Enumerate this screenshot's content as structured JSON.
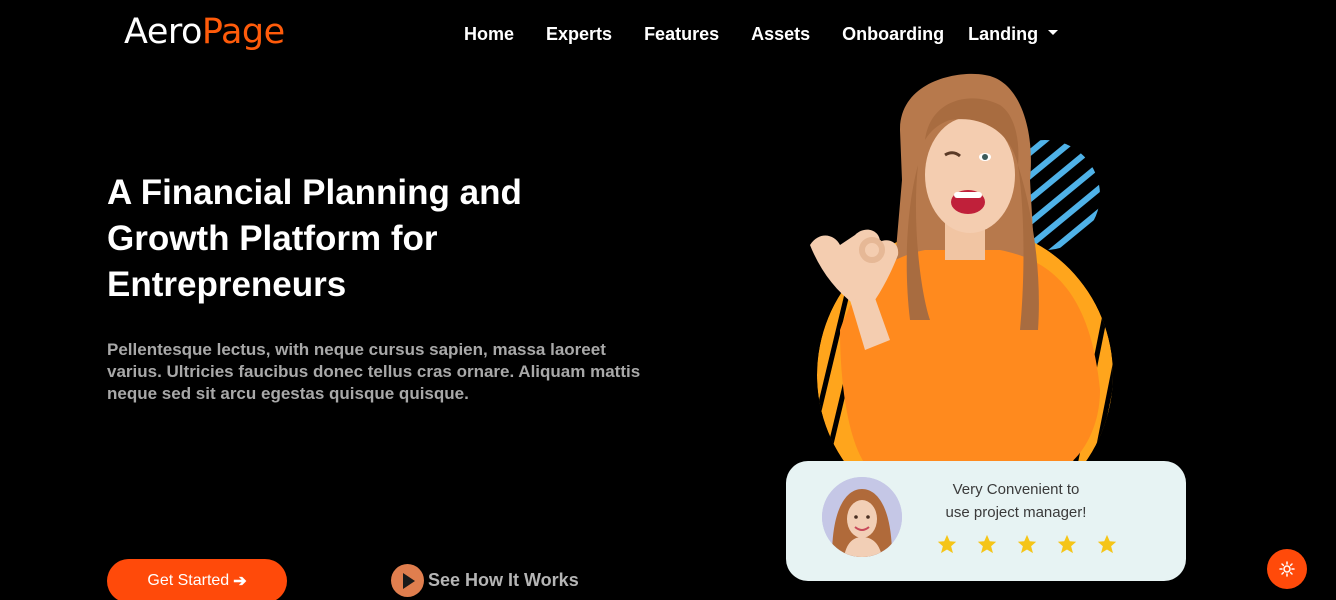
{
  "brand": {
    "part1": "Aero",
    "part2": "Page",
    "accent": "#ff5b0a"
  },
  "nav": {
    "items": [
      {
        "label": "Home"
      },
      {
        "label": "Experts"
      },
      {
        "label": "Features"
      },
      {
        "label": "Assets"
      },
      {
        "label": "Onboarding"
      },
      {
        "label": "Landing",
        "dropdown": true
      }
    ]
  },
  "hero": {
    "title": "A Financial Planning and Growth Platform for Entrepreneurs",
    "description": "Pellentesque lectus, with neque cursus sapien, massa laoreet varius. Ultricies faucibus donec tellus cras ornare. Aliquam mattis neque sed sit arcu egestas quisque quisque.",
    "cta_primary": "Get Started",
    "cta_primary_icon": "arrow-right-icon",
    "cta_secondary": "See How It Works",
    "cta_secondary_icon": "play-icon"
  },
  "review": {
    "text_line1": "Very Convenient to",
    "text_line2": "use project manager!",
    "rating": 5,
    "star_color": "#f5c518"
  },
  "settings": {
    "icon": "gear-icon"
  },
  "colors": {
    "background": "#000000",
    "accent": "#ff4a0a",
    "card": "#e7f3f3"
  }
}
